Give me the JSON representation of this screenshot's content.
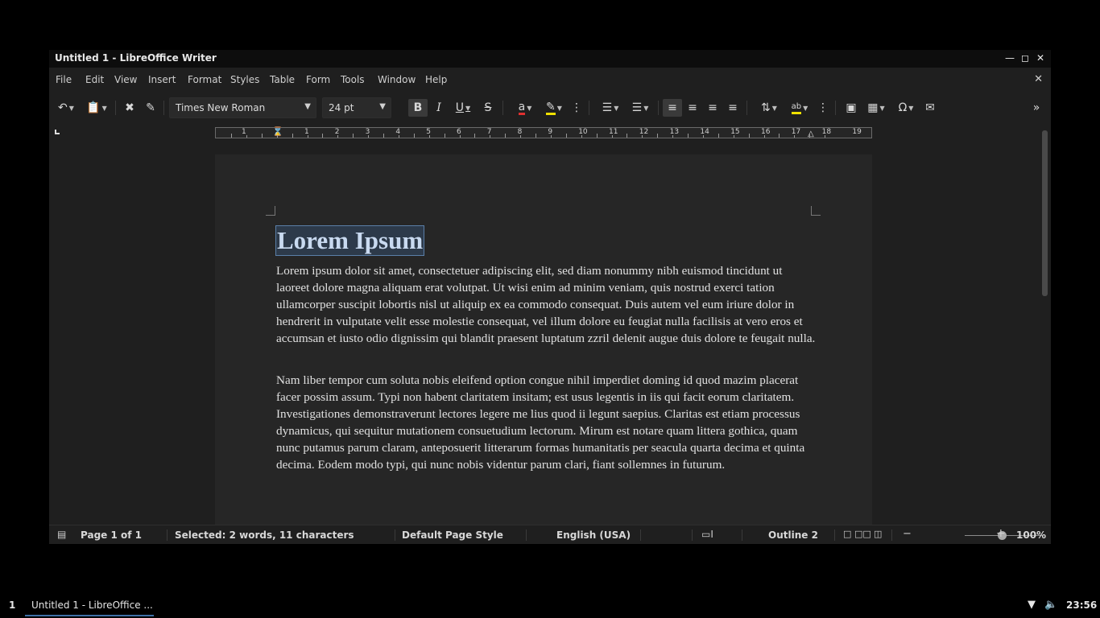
{
  "window": {
    "title": "Untitled 1 - LibreOffice Writer",
    "controls": [
      "minimize-icon",
      "maximize-icon",
      "close-icon"
    ]
  },
  "menubar": {
    "items": [
      "File",
      "Edit",
      "View",
      "Insert",
      "Format",
      "Styles",
      "Table",
      "Form",
      "Tools",
      "Window",
      "Help"
    ]
  },
  "toolbar": {
    "font_name": "Times New Roman",
    "font_size": "24 pt"
  },
  "ruler": {
    "left_numbers": [
      "1"
    ],
    "numbers": [
      "1",
      "2",
      "3",
      "4",
      "5",
      "6",
      "7",
      "8",
      "9",
      "10",
      "11",
      "12",
      "13",
      "14",
      "15",
      "16",
      "17",
      "18",
      "19"
    ]
  },
  "document": {
    "heading": "Lorem Ipsum",
    "paragraphs": [
      "Lorem ipsum dolor sit amet, consectetuer adipiscing elit, sed diam nonummy nibh euismod tincidunt ut laoreet dolore magna aliquam erat volutpat. Ut wisi enim ad minim veniam, quis nostrud exerci tation ullamcorper suscipit lobortis nisl ut aliquip ex ea commodo consequat. Duis autem vel eum iriure dolor in hendrerit in vulputate velit esse molestie consequat, vel illum dolore eu feugiat nulla facilisis at vero eros et accumsan et iusto odio dignissim qui blandit praesent luptatum zzril delenit augue duis dolore te feugait nulla.",
      "Nam liber tempor cum soluta nobis eleifend option congue nihil imperdiet doming id quod mazim placerat facer possim assum. Typi non habent claritatem insitam; est usus legentis in iis qui facit eorum claritatem. Investigationes demonstraverunt lectores legere me lius quod ii legunt saepius. Claritas est etiam processus dynamicus, qui sequitur mutationem consuetudium lectorum. Mirum est notare quam littera gothica, quam nunc putamus parum claram, anteposuerit litterarum formas humanitatis per seacula quarta decima et quinta decima. Eodem modo typi, qui nunc nobis videntur parum clari, fiant sollemnes in futurum."
    ]
  },
  "statusbar": {
    "page": "Page 1 of 1",
    "selection": "Selected: 2 words, 11 characters",
    "page_style": "Default Page Style",
    "language": "English (USA)",
    "outline": "Outline 2",
    "zoom": "100%"
  },
  "taskbar": {
    "workspace": "1",
    "task_label": "Untitled 1 - LibreOffice ...",
    "clock": "23:56"
  },
  "colors": {
    "accent": "#3d6fa6",
    "selection_bg": "#2d3a4a",
    "font_color_bar": "#e03030",
    "highlight_bar": "#f0e000"
  }
}
